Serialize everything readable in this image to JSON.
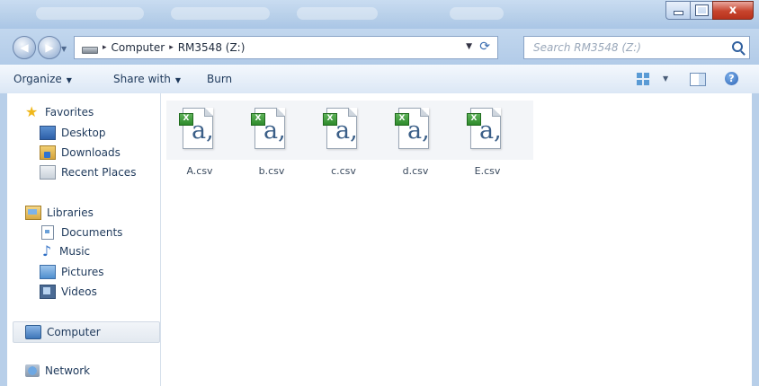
{
  "window": {
    "close_glyph": "x"
  },
  "address": {
    "crumbs": [
      "Computer",
      "RM3548 (Z:)"
    ],
    "separator": "▸"
  },
  "search": {
    "placeholder": "Search RM3548 (Z:)"
  },
  "toolbar": {
    "organize_label": "Organize",
    "share_label": "Share with",
    "burn_label": "Burn",
    "help_glyph": "?"
  },
  "nav": {
    "favorites": "Favorites",
    "desktop": "Desktop",
    "downloads": "Downloads",
    "recent": "Recent Places",
    "libraries": "Libraries",
    "documents": "Documents",
    "music": "Music",
    "pictures": "Pictures",
    "videos": "Videos",
    "computer": "Computer",
    "network": "Network"
  },
  "files": [
    {
      "name": "A.csv"
    },
    {
      "name": "b.csv"
    },
    {
      "name": "c.csv"
    },
    {
      "name": "d.csv"
    },
    {
      "name": "E.csv"
    }
  ],
  "file_glyph": "a,",
  "colors": {
    "frame": "#b8cfe9",
    "accent": "#1e395b",
    "close_red": "#c7442d",
    "excel_green": "#2e8a2b"
  }
}
